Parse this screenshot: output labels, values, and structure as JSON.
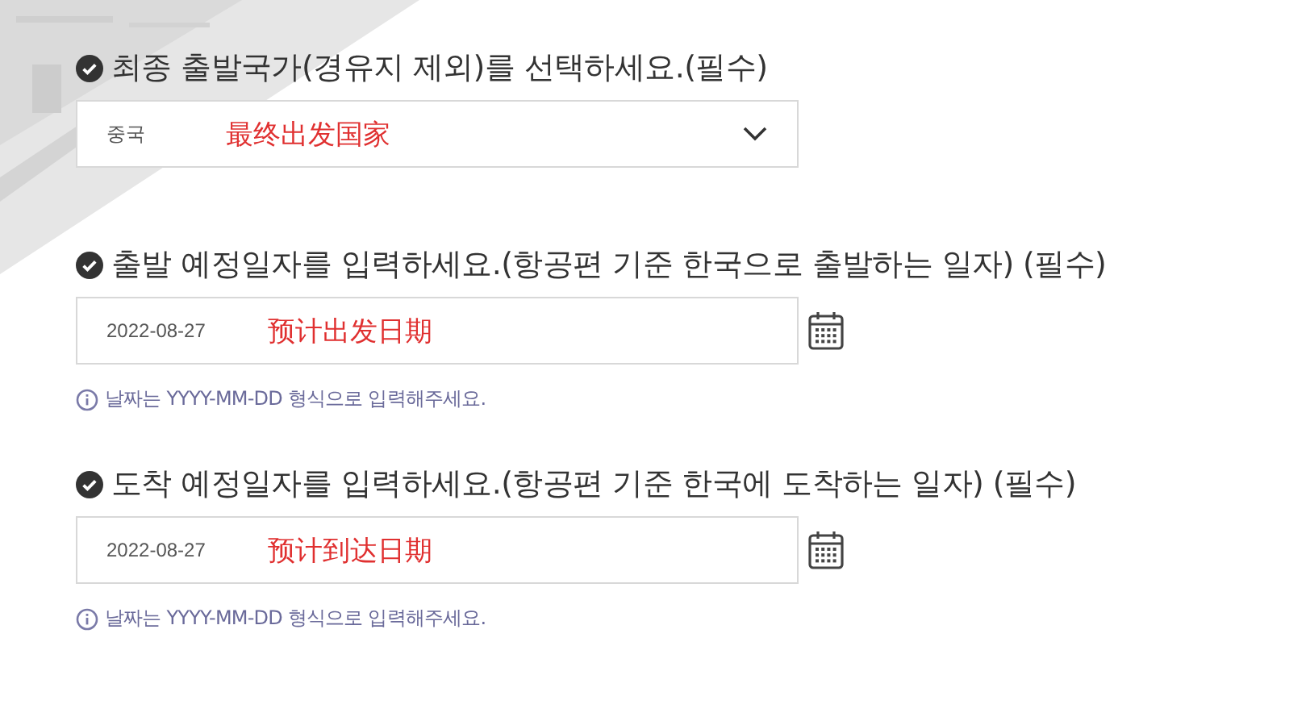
{
  "fields": [
    {
      "kind": "select",
      "label": "최종 출발국가(경유지 제외)를 선택하세요.(필수)",
      "value": "중국",
      "annotation": "最终出发国家"
    },
    {
      "kind": "date",
      "label": "출발 예정일자를 입력하세요.(항공편 기준 한국으로 출발하는 일자) (필수)",
      "value": "2022-08-27",
      "annotation": "预计出发日期",
      "hint": "날짜는 YYYY-MM-DD 형식으로 입력해주세요."
    },
    {
      "kind": "date",
      "label": "도착 예정일자를 입력하세요.(항공편 기준 한국에 도착하는 일자) (필수)",
      "value": "2022-08-27",
      "annotation": "预计到达日期",
      "hint": "날짜는 YYYY-MM-DD 형식으로 입력해주세요."
    }
  ]
}
